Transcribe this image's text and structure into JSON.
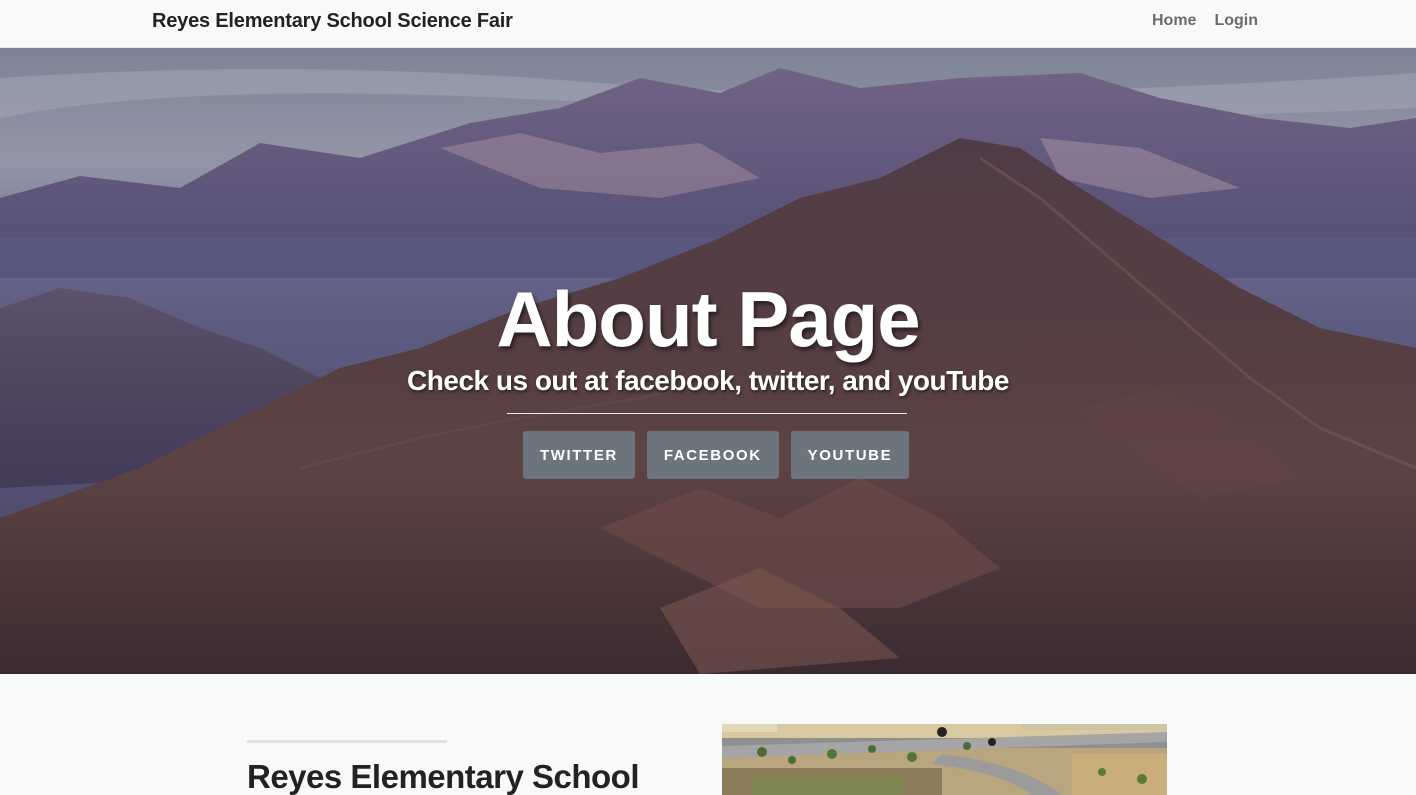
{
  "navbar": {
    "brand": "Reyes Elementary School Science Fair",
    "links": [
      {
        "label": "Home"
      },
      {
        "label": "Login"
      }
    ]
  },
  "hero": {
    "title": "About Page",
    "subtitle": "Check us out at facebook, twitter, and youTube",
    "buttons": [
      {
        "label": "TWITTER"
      },
      {
        "label": "FACEBOOK"
      },
      {
        "label": "YOUTUBE"
      }
    ],
    "background_image": "mountain-range-photo"
  },
  "about": {
    "heading": "Reyes Elementary School",
    "image": "school-aerial-photo"
  },
  "colors": {
    "navbar_bg": "#f8f9fa",
    "button_bg": "#6c757d",
    "hero_text": "#ffffff",
    "section_bg": "#f8f9fa"
  }
}
